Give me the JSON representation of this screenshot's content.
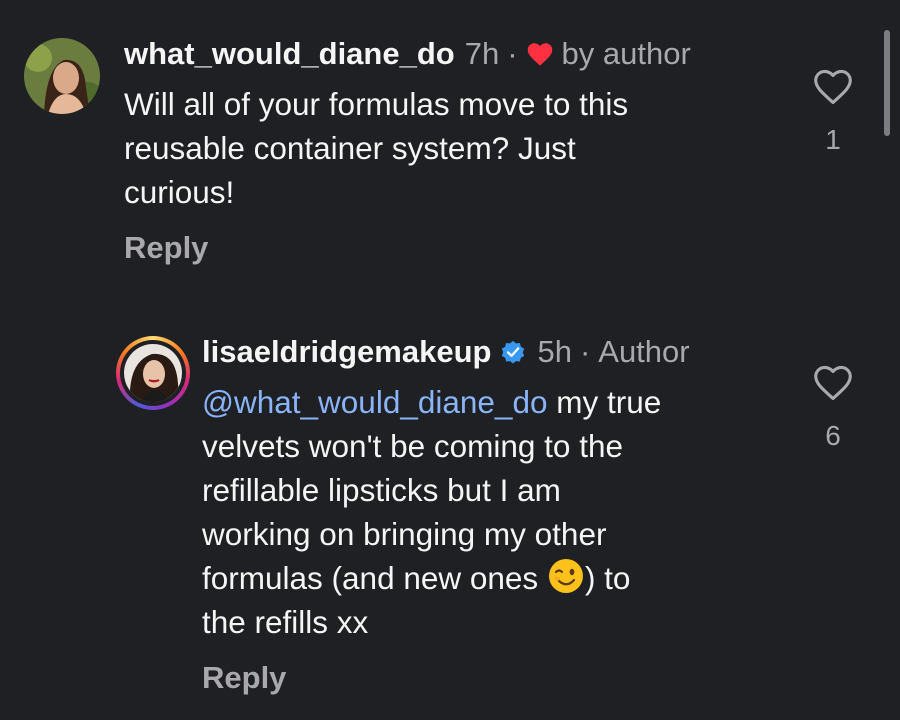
{
  "comments": [
    {
      "username": "what_would_diane_do",
      "time": "7h",
      "liked_by_author_label": "by author",
      "text_lines": [
        "Will all of your formulas move to this",
        "reusable container system?  Just",
        "curious!"
      ],
      "reply_label": "Reply",
      "like_count": "1"
    },
    {
      "username": "lisaeldridgemakeup",
      "time": "5h",
      "badge_label": "Author",
      "mention": "@what_would_diane_do",
      "text_line1_rest": " my true",
      "text_lines": [
        "velvets won't be coming to the",
        "refillable lipsticks but I am",
        "working on bringing my other"
      ],
      "text_line5_before_emoji": "formulas (and new ones ",
      "text_line5_after_emoji": ") to",
      "text_line6": "the refills xx",
      "reply_label": "Reply",
      "like_count": "6"
    }
  ],
  "icons": {
    "heart": "heart-outline-icon",
    "liked": "heart-filled-icon",
    "verified": "verified-badge-icon",
    "emoji": "winking-face-emoji"
  },
  "colors": {
    "background": "#1f2024",
    "text": "#f5f5f5",
    "secondary": "#a8a8ad",
    "mention": "#8ab4f8",
    "heart_red": "#ff3040",
    "verified_blue": "#3897f0"
  }
}
